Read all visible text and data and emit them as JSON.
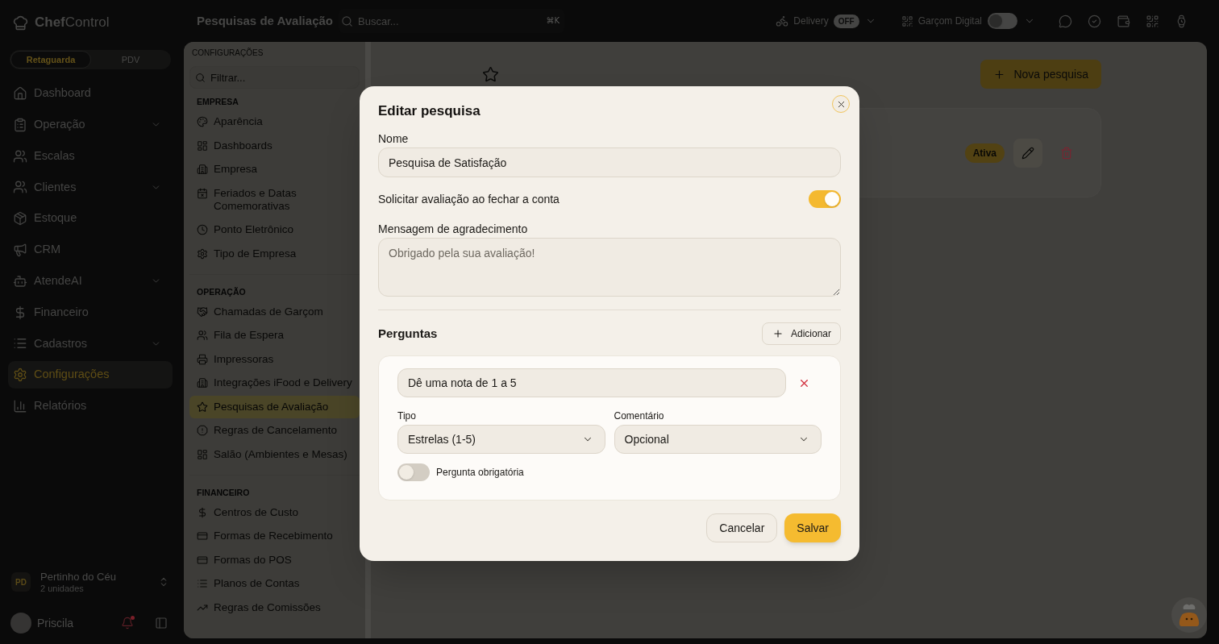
{
  "brand": {
    "name": "**Chef**Control"
  },
  "mode_switch": [
    {
      "label": "Retaguarda",
      "selected": true
    },
    {
      "label": "PDV",
      "selected": false
    }
  ],
  "nav": [
    {
      "label": "Dashboard",
      "expandable": false,
      "selected": false
    },
    {
      "label": "Operação",
      "expandable": true,
      "selected": false
    },
    {
      "label": "Escalas",
      "expandable": false,
      "selected": false
    },
    {
      "label": "Clientes",
      "expandable": true,
      "selected": false
    },
    {
      "label": "Estoque",
      "expandable": false,
      "selected": false
    },
    {
      "label": "CRM",
      "expandable": false,
      "selected": false
    },
    {
      "label": "AtendeAI",
      "expandable": true,
      "selected": false
    },
    {
      "label": "Financeiro",
      "expandable": false,
      "selected": false
    },
    {
      "label": "Cadastros",
      "expandable": true,
      "selected": false
    },
    {
      "label": "Configurações",
      "expandable": false,
      "selected": true
    },
    {
      "label": "Relatórios",
      "expandable": false,
      "selected": false
    }
  ],
  "organization": {
    "initials": "PD",
    "name": "Pertinho do Céu",
    "subtitle": "2 unidades"
  },
  "user": {
    "name": "Priscila",
    "unread": true
  },
  "topbar": {
    "title": "Pesquisas de Avaliação",
    "search": {
      "placeholder": "Buscar...",
      "shortcut": "⌘K"
    },
    "delivery": {
      "label": "Delivery",
      "status": "OFF"
    },
    "waiter": {
      "label": "Garçom Digital",
      "on": false
    }
  },
  "settings": {
    "title": "CONFIGURAÇÕES",
    "filter": {
      "placeholder": "Filtrar..."
    },
    "sections": [
      {
        "title": "EMPRESA",
        "items": [
          {
            "label": "Aparência",
            "selected": false
          },
          {
            "label": "Dashboards",
            "selected": false
          },
          {
            "label": "Empresa",
            "selected": false
          },
          {
            "label": "Feriados e Datas Comemorativas",
            "selected": false
          },
          {
            "label": "Ponto Eletrônico",
            "selected": false
          },
          {
            "label": "Tipo de Empresa",
            "selected": false
          }
        ]
      },
      {
        "title": "OPERAÇÃO",
        "items": [
          {
            "label": "Chamadas de Garçom",
            "selected": false
          },
          {
            "label": "Fila de Espera",
            "selected": false
          },
          {
            "label": "Impressoras",
            "selected": false
          },
          {
            "label": "Integrações iFood e Delivery",
            "selected": false
          },
          {
            "label": "Pesquisas de Avaliação",
            "selected": true
          },
          {
            "label": "Regras de Cancelamento",
            "selected": false
          },
          {
            "label": "Salão (Ambientes e Mesas)",
            "selected": false
          }
        ]
      },
      {
        "title": "FINANCEIRO",
        "items": [
          {
            "label": "Centros de Custo",
            "selected": false
          },
          {
            "label": "Formas de Recebimento",
            "selected": false
          },
          {
            "label": "Formas do POS",
            "selected": false
          },
          {
            "label": "Planos de Contas",
            "selected": false
          },
          {
            "label": "Regras de Comissões",
            "selected": false
          }
        ]
      }
    ]
  },
  "main": {
    "new_button": "Nova pesquisa",
    "survey_card": {
      "status": "Ativa"
    }
  },
  "modal": {
    "title": "Editar pesquisa",
    "name_field": {
      "label": "Nome",
      "value": "Pesquisa de Satisfação"
    },
    "request_toggle": {
      "label": "Solicitar avaliação ao fechar a conta",
      "on": true
    },
    "message_field": {
      "label": "Mensagem de agradecimento",
      "placeholder": "Obrigado pela sua avaliação!"
    },
    "questions": {
      "title": "Perguntas",
      "add_button": "Adicionar",
      "items": [
        {
          "text": "Dê uma nota de 1 a 5",
          "type_label": "Tipo",
          "type_value": "Estrelas (1-5)",
          "comment_label": "Comentário",
          "comment_value": "Opcional",
          "required_label": "Pergunta obrigatória",
          "required": false
        }
      ]
    },
    "buttons": {
      "cancel": "Cancelar",
      "save": "Salvar"
    }
  }
}
